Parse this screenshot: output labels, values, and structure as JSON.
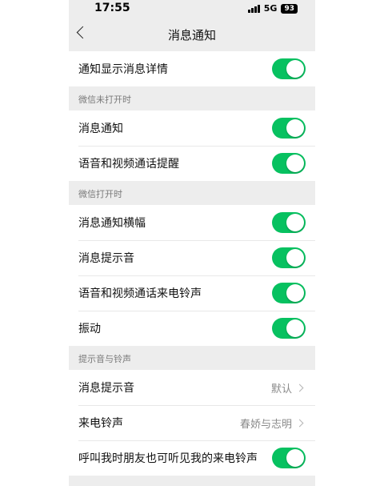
{
  "status_bar": {
    "time": "17:55",
    "network": "5G",
    "battery": "93"
  },
  "header": {
    "title": "消息通知"
  },
  "rows_top": {
    "show_details": {
      "label": "通知显示消息详情",
      "on": true
    }
  },
  "section_closed": {
    "title": "微信未打开时",
    "items": [
      {
        "label": "消息通知",
        "on": true
      },
      {
        "label": "语音和视频通话提醒",
        "on": true
      }
    ]
  },
  "section_open": {
    "title": "微信打开时",
    "items": [
      {
        "label": "消息通知横幅",
        "on": true
      },
      {
        "label": "消息提示音",
        "on": true
      },
      {
        "label": "语音和视频通话来电铃声",
        "on": true
      },
      {
        "label": "振动",
        "on": true
      }
    ]
  },
  "section_sounds": {
    "title": "提示音与铃声",
    "items": [
      {
        "label": "消息提示音",
        "value": "默认"
      },
      {
        "label": "来电铃声",
        "value": "春娇与志明"
      }
    ],
    "friend_ringtone": {
      "label": "呼叫我时朋友也可听见我的来电铃声",
      "on": true
    }
  },
  "colors": {
    "accent": "#07c160",
    "background": "#ededed"
  }
}
